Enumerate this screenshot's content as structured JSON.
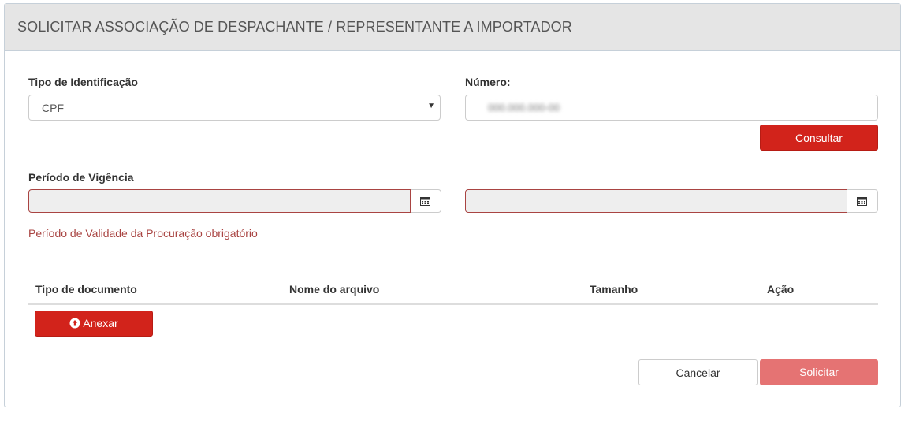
{
  "header": {
    "title": "SOLICITAR ASSOCIAÇÃO DE DESPACHANTE / REPRESENTANTE A IMPORTADOR"
  },
  "identification": {
    "type_label": "Tipo de Identificação",
    "type_value": "CPF",
    "number_label": "Número:",
    "number_value": "000.000.000-00",
    "consult_label": "Consultar"
  },
  "validity": {
    "label": "Período de Vigência",
    "start_value": "",
    "end_value": "",
    "error": "Período de Validade da Procuração obrigatório"
  },
  "documents": {
    "columns": [
      "Tipo de documento",
      "Nome do arquivo",
      "Tamanho",
      "Ação"
    ],
    "attach_label": "Anexar"
  },
  "footer": {
    "cancel_label": "Cancelar",
    "submit_label": "Solicitar"
  },
  "colors": {
    "primary": "#d2231b",
    "disabled_primary": "#e57373",
    "error": "#a94442"
  }
}
